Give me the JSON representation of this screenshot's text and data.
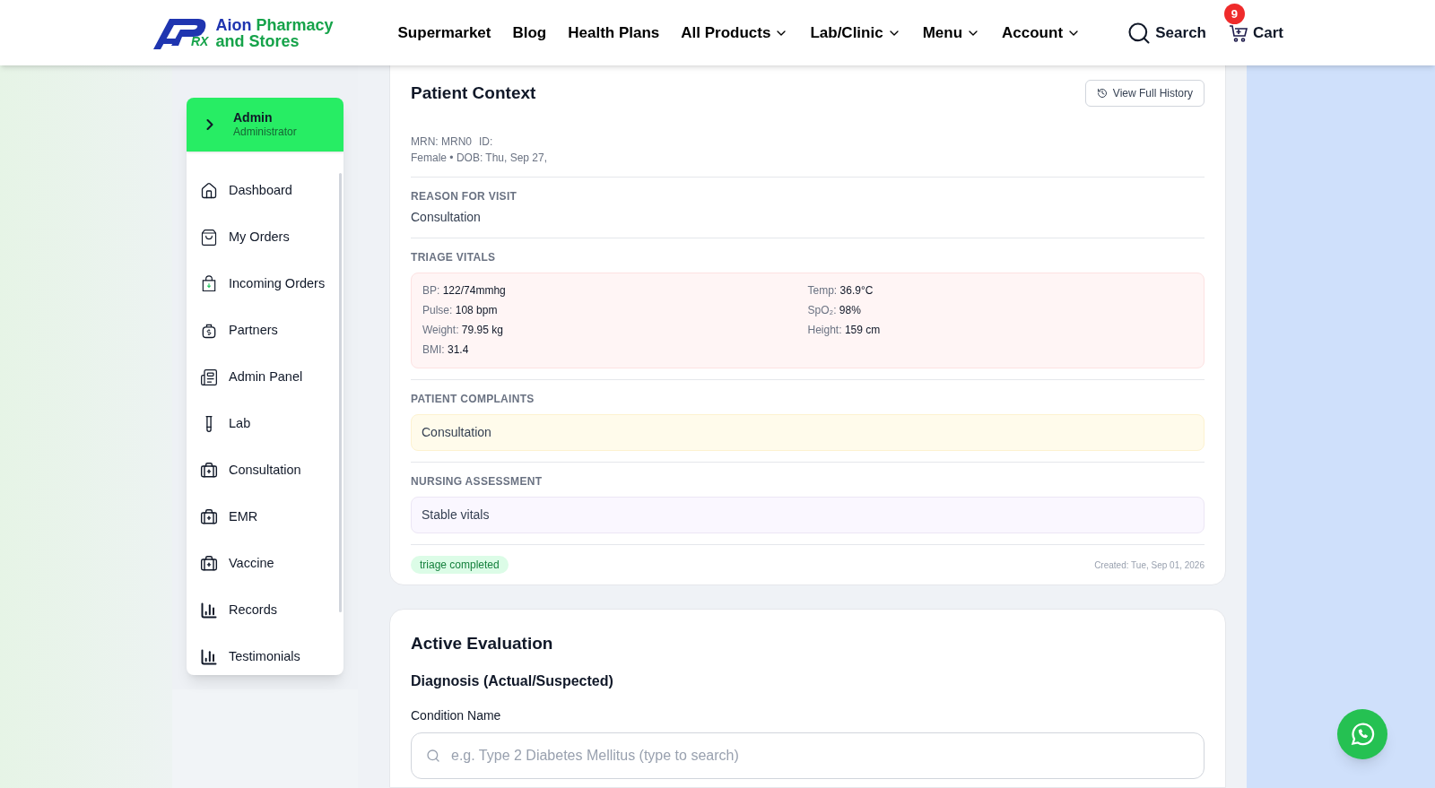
{
  "header": {
    "logo": {
      "mark": "RX",
      "line1_a": "Aion",
      "line1_b": "Pharmacy",
      "line2": "and Stores"
    },
    "nav": [
      {
        "label": "Supermarket",
        "dropdown": false
      },
      {
        "label": "Blog",
        "dropdown": false
      },
      {
        "label": "Health Plans",
        "dropdown": false
      },
      {
        "label": "All Products",
        "dropdown": true
      },
      {
        "label": "Lab/Clinic",
        "dropdown": true
      },
      {
        "label": "Menu",
        "dropdown": true
      },
      {
        "label": "Account",
        "dropdown": true
      }
    ],
    "search": "Search",
    "cart": {
      "label": "Cart",
      "count": "9"
    }
  },
  "sidebar": {
    "user": {
      "name": "Admin",
      "role": "Administrator"
    },
    "items": [
      {
        "label": "Dashboard",
        "kind": "home"
      },
      {
        "label": "My Orders",
        "kind": "bag"
      },
      {
        "label": "Incoming Orders",
        "kind": "incoming"
      },
      {
        "label": "Partners",
        "kind": "money"
      },
      {
        "label": "Admin Panel",
        "kind": "panel"
      },
      {
        "label": "Lab",
        "kind": "tube"
      },
      {
        "label": "Consultation",
        "kind": "kit"
      },
      {
        "label": "EMR",
        "kind": "kit"
      },
      {
        "label": "Vaccine",
        "kind": "kit"
      },
      {
        "label": "Records",
        "kind": "chart"
      },
      {
        "label": "Testimonials",
        "kind": "chart"
      }
    ]
  },
  "patient_context": {
    "title": "Patient Context",
    "history_button": "View Full History",
    "patient": {
      "mrn": "MRN: MRN0",
      "id": "ID:",
      "details": "Female • DOB: Thu, Sep 27,"
    },
    "reason": {
      "heading": "REASON FOR VISIT",
      "value": "Consultation"
    },
    "vitals": {
      "heading": "TRIAGE VITALS",
      "items": [
        {
          "label": "BP:",
          "value": "122/74mmhg"
        },
        {
          "label": "Temp:",
          "value": "36.9°C"
        },
        {
          "label": "Pulse:",
          "value": "108 bpm"
        },
        {
          "label": "SpO₂:",
          "value": "98%"
        },
        {
          "label": "Weight:",
          "value": "79.95 kg"
        },
        {
          "label": "Height:",
          "value": "159 cm"
        },
        {
          "label": "BMI:",
          "value": "31.4"
        }
      ]
    },
    "complaints": {
      "heading": "PATIENT COMPLAINTS",
      "value": "Consultation"
    },
    "nursing": {
      "heading": "NURSING ASSESSMENT",
      "value": "Stable vitals"
    },
    "status": "triage completed",
    "created": "Created: Tue, Sep 01, 2026"
  },
  "evaluation": {
    "title": "Active Evaluation",
    "subtitle": "Diagnosis (Actual/Suspected)",
    "field_label": "Condition Name",
    "placeholder": "e.g. Type 2 Diabetes Mellitus (type to search)"
  }
}
